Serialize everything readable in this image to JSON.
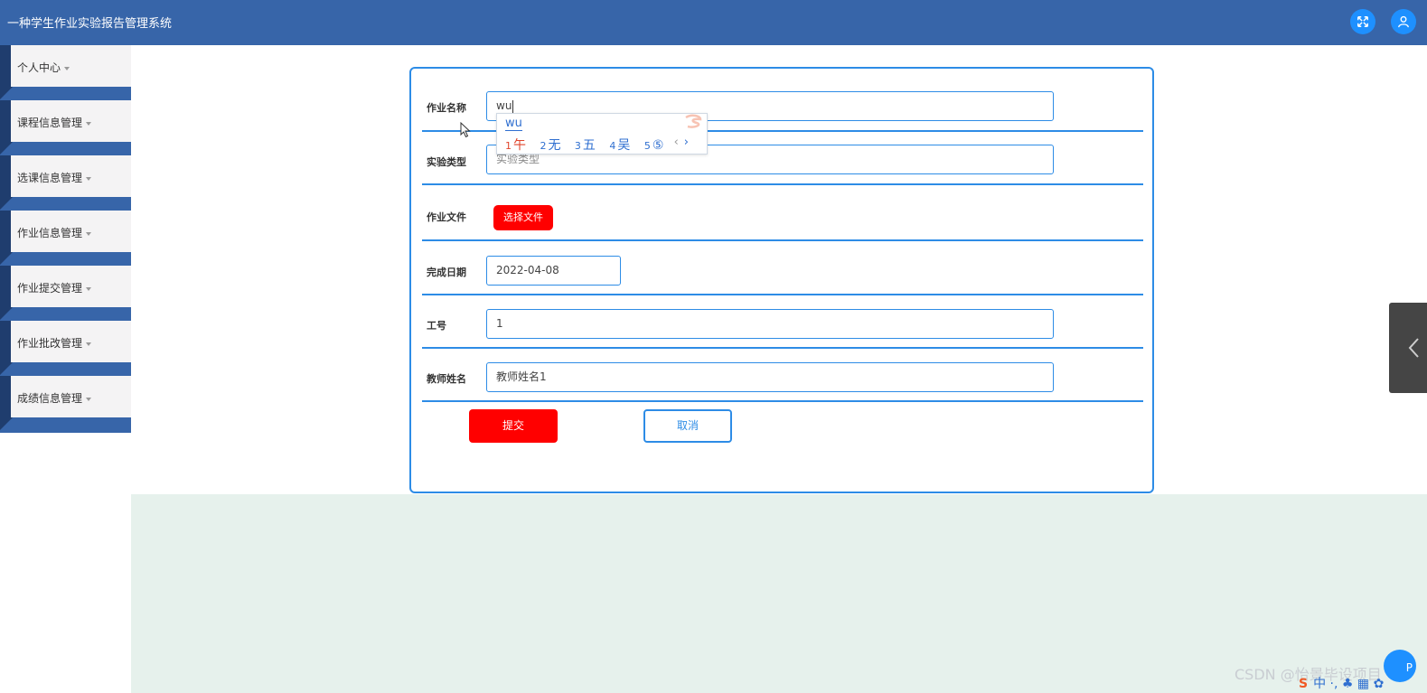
{
  "header": {
    "title": "一种学生作业实验报告管理系统",
    "fullscreen_icon": "fullscreen-icon",
    "user_icon": "user-icon",
    "accent": "#3765a9"
  },
  "sidebar": {
    "items": [
      {
        "label": "个人中心"
      },
      {
        "label": "课程信息管理"
      },
      {
        "label": "选课信息管理"
      },
      {
        "label": "作业信息管理"
      },
      {
        "label": "作业提交管理"
      },
      {
        "label": "作业批改管理"
      },
      {
        "label": "成绩信息管理"
      }
    ]
  },
  "form": {
    "homework_name": {
      "label": "作业名称",
      "value": "wu"
    },
    "experiment_type": {
      "label": "实验类型",
      "placeholder": "实验类型"
    },
    "homework_file": {
      "label": "作业文件",
      "button": "选择文件"
    },
    "due_date": {
      "label": "完成日期",
      "value": "2022-04-08"
    },
    "employee_id": {
      "label": "工号",
      "value": "1"
    },
    "teacher_name": {
      "label": "教师姓名",
      "value": "教师姓名1"
    },
    "submit_label": "提交",
    "cancel_label": "取消",
    "border_color": "#2d8ce6",
    "primary_color": "#ff0000"
  },
  "ime": {
    "typed": "wu",
    "candidates": [
      {
        "num": "1",
        "text": "午"
      },
      {
        "num": "2",
        "text": "无"
      },
      {
        "num": "3",
        "text": "五"
      },
      {
        "num": "4",
        "text": "吴"
      },
      {
        "num": "5",
        "text": "⑤"
      }
    ],
    "prev": "‹",
    "next": "›"
  },
  "overlay": {
    "watermark": "CSDN @怡景毕设项目",
    "float_button": "P",
    "tray": "中 ·, ♣ ▦ ✿"
  }
}
